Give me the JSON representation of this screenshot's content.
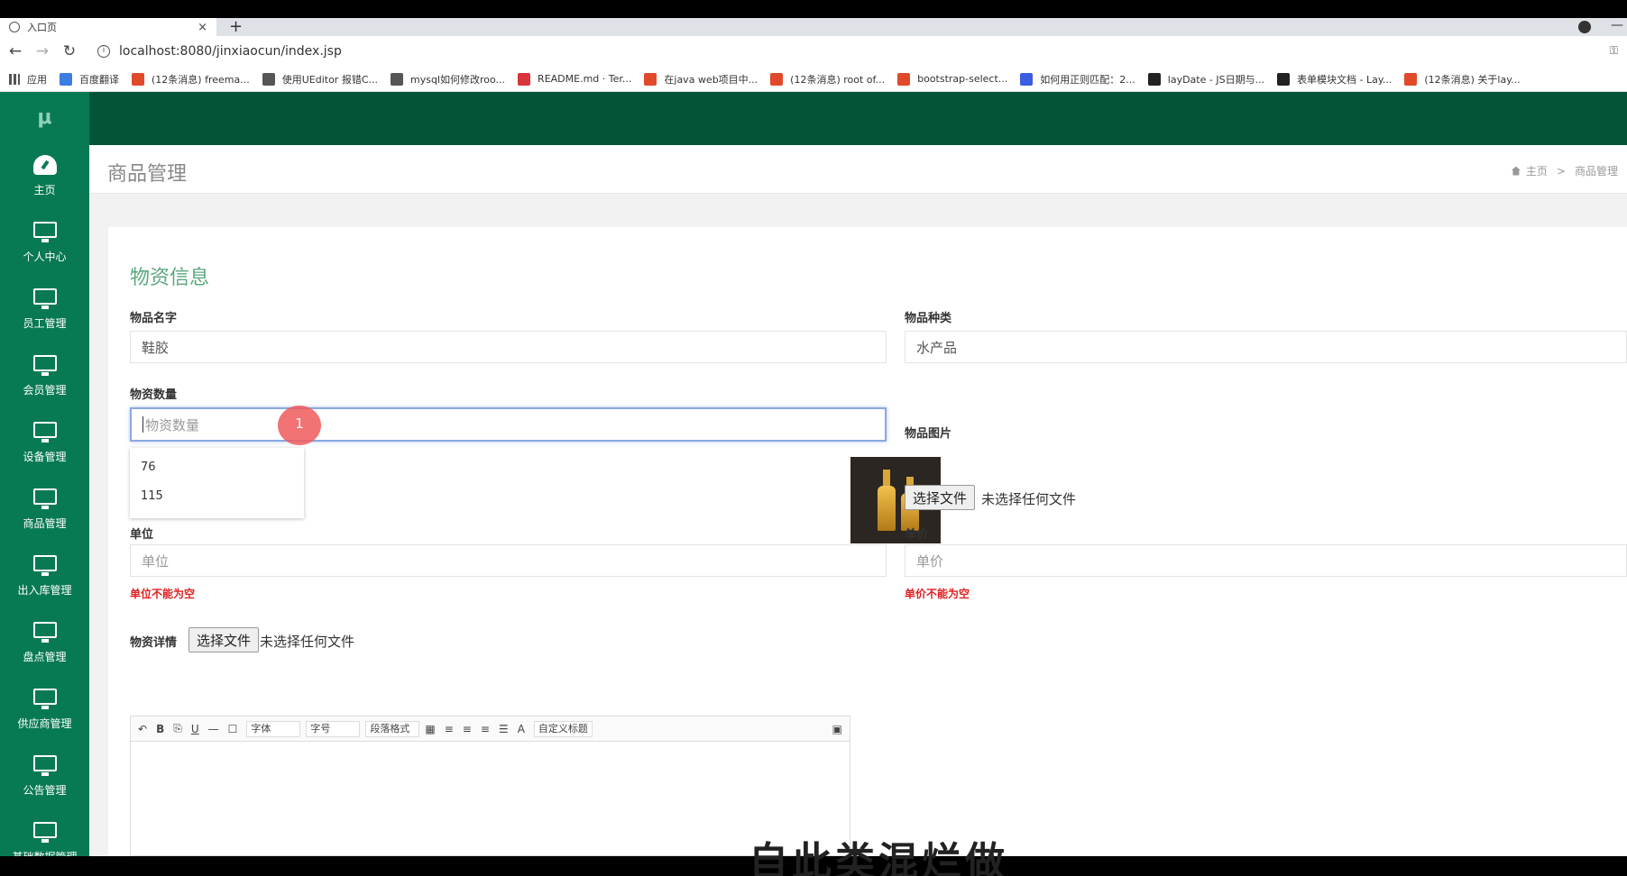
{
  "browser": {
    "tab_title": "入口页",
    "tab_close": "×",
    "new_tab": "+",
    "url": "localhost:8080/jinxiaocun/index.jsp",
    "bookmarks": [
      {
        "label": "应用",
        "color": "#777777"
      },
      {
        "label": "百度翻译",
        "color": "#3b7de0"
      },
      {
        "label": "(12条消息) freema...",
        "color": "#e04a2a"
      },
      {
        "label": "使用UEditor 报错C...",
        "color": "#555555"
      },
      {
        "label": "mysql如何修改roo...",
        "color": "#555555"
      },
      {
        "label": "README.md · Ter...",
        "color": "#d9343a"
      },
      {
        "label": "在java web项目中...",
        "color": "#e04a2a"
      },
      {
        "label": "(12条消息) root of...",
        "color": "#e04a2a"
      },
      {
        "label": "bootstrap-select...",
        "color": "#e04a2a"
      },
      {
        "label": "如何用正则匹配：2...",
        "color": "#3b5de0"
      },
      {
        "label": "layDate - JS日期与...",
        "color": "#222222"
      },
      {
        "label": "表单模块文档 - Lay...",
        "color": "#222222"
      },
      {
        "label": "(12条消息) 关于lay...",
        "color": "#e04a2a"
      }
    ]
  },
  "sidebar": {
    "logo": "μ",
    "items": [
      {
        "label": "主页",
        "icon": "dashboard-icon"
      },
      {
        "label": "个人中心",
        "icon": "monitor-icon"
      },
      {
        "label": "员工管理",
        "icon": "monitor-icon"
      },
      {
        "label": "会员管理",
        "icon": "monitor-icon"
      },
      {
        "label": "设备管理",
        "icon": "monitor-icon"
      },
      {
        "label": "商品管理",
        "icon": "monitor-icon"
      },
      {
        "label": "出入库管理",
        "icon": "monitor-icon"
      },
      {
        "label": "盘点管理",
        "icon": "monitor-icon"
      },
      {
        "label": "供应商管理",
        "icon": "monitor-icon"
      },
      {
        "label": "公告管理",
        "icon": "monitor-icon"
      },
      {
        "label": "基础数据管理",
        "icon": "monitor-icon"
      }
    ]
  },
  "header": {
    "title": "商品管理",
    "breadcrumb_home": "主页",
    "breadcrumb_sep": ">",
    "breadcrumb_current": "商品管理"
  },
  "form": {
    "section_title": "物资信息",
    "name_label": "物品名字",
    "name_value": "鞋胶",
    "category_label": "物品种类",
    "category_value": "水产品",
    "quantity_label": "物资数量",
    "quantity_placeholder": "物资数量",
    "quantity_suggestions": [
      "76",
      "115"
    ],
    "image_label": "物品图片",
    "file_button": "选择文件",
    "file_none": "未选择任何文件",
    "unit_label": "单位",
    "unit_placeholder": "单位",
    "unit_error": "单位不能为空",
    "price_label": "单价",
    "price_placeholder": "单价",
    "price_error": "单价不能为空",
    "detail_label": "物资详情",
    "marker": "1"
  },
  "editor": {
    "font_select": "字体",
    "size_select": "字号",
    "para_select": "段落格式",
    "custom_title": "自定义标题",
    "bold": "B",
    "underline": "U",
    "color": "A"
  },
  "overlay_text": "自此类混烂做"
}
